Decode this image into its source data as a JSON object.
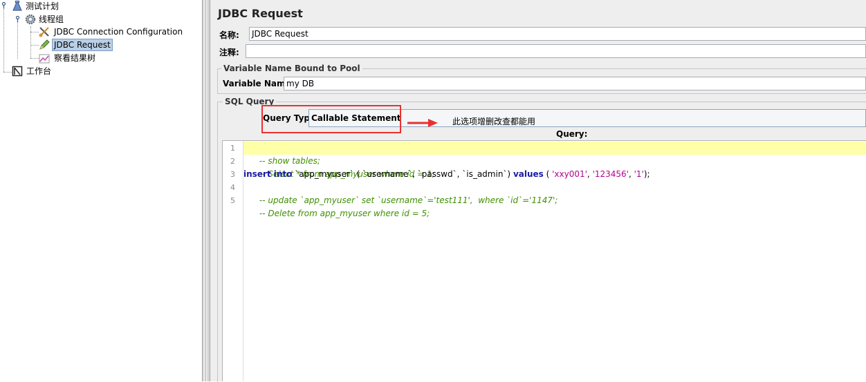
{
  "tree": {
    "items": [
      {
        "label": "测试计划",
        "icon": "flask-icon"
      },
      {
        "label": "线程组",
        "icon": "gear-icon"
      },
      {
        "label": "JDBC Connection Configuration",
        "icon": "wrench-scissors-icon"
      },
      {
        "label": "JDBC Request",
        "icon": "pen-icon"
      },
      {
        "label": "察看结果树",
        "icon": "chart-icon"
      },
      {
        "label": "工作台",
        "icon": "workbench-icon"
      }
    ]
  },
  "panel": {
    "title": "JDBC Request",
    "name_label": "名称:",
    "name_value": "JDBC Request",
    "comment_label": "注释:",
    "comment_value": "",
    "variable_group_title": "Variable Name Bound to Pool",
    "variable_name_label": "Variable Name:",
    "variable_name_value": "my DB",
    "sql_group_title": "SQL Query",
    "query_type_label": "Query Type:",
    "query_type_value": "Callable Statement",
    "annotation": "此选项增删改查都能用",
    "query_label": "Query:"
  },
  "editor": {
    "line_numbers": [
      "1",
      "2",
      "3",
      "4",
      "5"
    ],
    "lines": {
      "l1": "-- show tables;",
      "l2": "-- Select * from app_myuser where id = 1;",
      "l3": {
        "kw1": "insert into",
        "p1": " `app_myuser` ( `username`, `passwd`, `is_admin`) ",
        "kw2": "values",
        "p2": " ( ",
        "s1": "'xxy001'",
        "p3": ", ",
        "s2": "'123456'",
        "p4": ", ",
        "s3": "'1'",
        "p5": ");"
      },
      "l4": "-- update `app_myuser` set `username`='test111',  where `id`='1147';",
      "l5": "-- Delete from app_myuser where id = 5;"
    }
  },
  "colors": {
    "highlight": "#e8312f",
    "comment": "#3f8f00",
    "keyword": "#1a1aa6",
    "string": "#b3008f",
    "current_line": "#ffffa8",
    "selection": "#b9cfe6"
  }
}
